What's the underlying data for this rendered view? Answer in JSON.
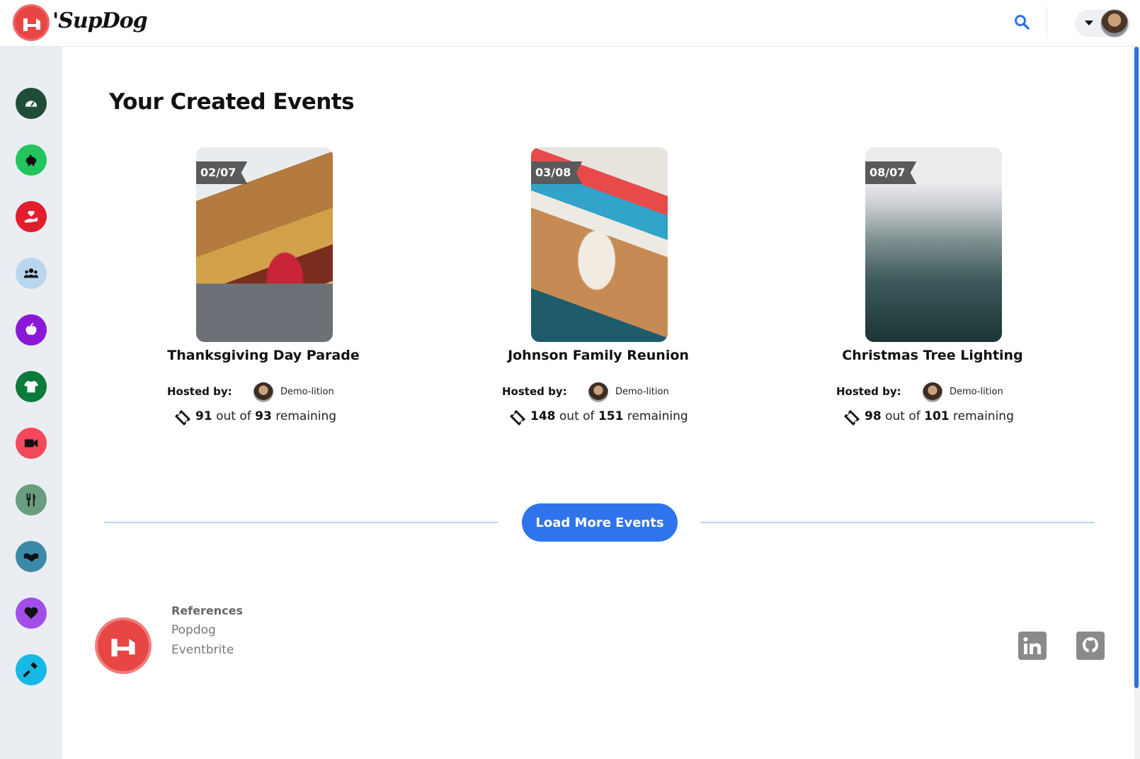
{
  "app": {
    "brand": "'SupDog"
  },
  "header": {
    "search_icon": "search-icon",
    "user_menu_icon": "caret-down-icon"
  },
  "sidebar": {
    "items": [
      {
        "icon": "dashboard-gauge-icon",
        "color": "#1f4d3a"
      },
      {
        "icon": "piggy-bank-icon",
        "color": "#22c55e"
      },
      {
        "icon": "hand-holding-heart-icon",
        "color": "#e11d2e"
      },
      {
        "icon": "users-icon",
        "color": "#b9d6ee"
      },
      {
        "icon": "apple-icon",
        "color": "#8b18d6"
      },
      {
        "icon": "tshirt-icon",
        "color": "#0b7a3a"
      },
      {
        "icon": "video-camera-icon",
        "color": "#f2495b"
      },
      {
        "icon": "utensils-icon",
        "color": "#6a9d7f"
      },
      {
        "icon": "handshake-icon",
        "color": "#3b8aa8"
      },
      {
        "icon": "heart-icon",
        "color": "#a14fe8"
      },
      {
        "icon": "hammer-icon",
        "color": "#16b8e6"
      }
    ]
  },
  "main": {
    "title": "Your Created Events",
    "events": [
      {
        "date": "02/07",
        "title": "Thanksgiving Day Parade",
        "hosted_label": "Hosted by:",
        "host": "Demo-lition",
        "remaining": "91",
        "total": "93",
        "out_of": "out of",
        "remaining_label": "remaining",
        "image": "parade-float-photo"
      },
      {
        "date": "03/08",
        "title": "Johnson Family Reunion",
        "hosted_label": "Hosted by:",
        "host": "Demo-lition",
        "remaining": "148",
        "total": "151",
        "out_of": "out of",
        "remaining_label": "remaining",
        "image": "back-to-school-desk-photo"
      },
      {
        "date": "08/07",
        "title": "Christmas Tree Lighting",
        "hosted_label": "Hosted by:",
        "host": "Demo-lition",
        "remaining": "98",
        "total": "101",
        "out_of": "out of",
        "remaining_label": "remaining",
        "image": "foggy-mountain-photo"
      }
    ],
    "load_more_label": "Load More Events"
  },
  "footer": {
    "references_title": "References",
    "links": [
      "Popdog",
      "Eventbrite"
    ],
    "social": [
      "linkedin-icon",
      "github-icon"
    ]
  },
  "colors": {
    "accent": "#2f74ec",
    "brand_red": "#e84545"
  }
}
